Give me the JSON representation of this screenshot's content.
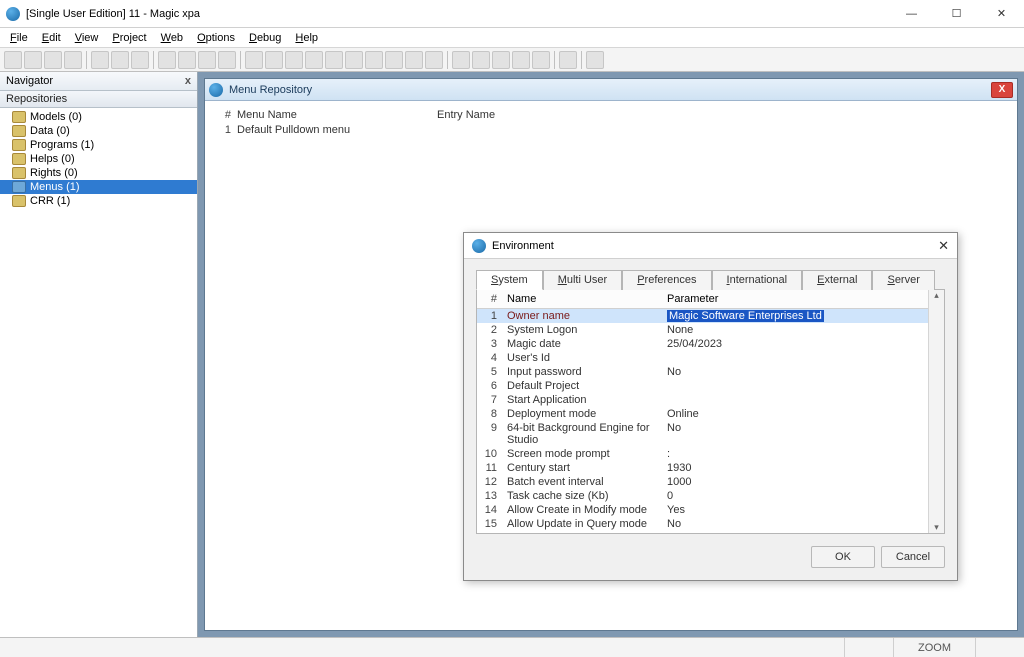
{
  "window": {
    "title": "[Single User Edition] 11 - Magic xpa"
  },
  "menubar": [
    "File",
    "Edit",
    "View",
    "Project",
    "Web",
    "Options",
    "Debug",
    "Help"
  ],
  "navigator": {
    "title": "Navigator",
    "section": "Repositories",
    "items": [
      {
        "label": "Models  (0)"
      },
      {
        "label": "Data  (0)"
      },
      {
        "label": "Programs  (1)"
      },
      {
        "label": "Helps  (0)"
      },
      {
        "label": "Rights  (0)"
      },
      {
        "label": "Menus  (1)",
        "selected": true
      },
      {
        "label": "CRR  (1)"
      }
    ]
  },
  "mdi": {
    "title": "Menu Repository",
    "columns": {
      "index": "#",
      "menu": "Menu Name",
      "entry": "Entry Name"
    },
    "rows": [
      {
        "index": "1",
        "menu": "Default Pulldown menu",
        "entry": ""
      }
    ]
  },
  "env": {
    "title": "Environment",
    "tabs": [
      "System",
      "Multi User",
      "Preferences",
      "International",
      "External",
      "Server"
    ],
    "active_tab": 0,
    "columns": {
      "index": "#",
      "name": "Name",
      "param": "Parameter"
    },
    "rows": [
      {
        "i": "1",
        "name": "Owner name",
        "param": "Magic Software Enterprises Ltd",
        "selected": true
      },
      {
        "i": "2",
        "name": "System Logon",
        "param": "None"
      },
      {
        "i": "3",
        "name": "Magic date",
        "param": "25/04/2023"
      },
      {
        "i": "4",
        "name": "User's Id",
        "param": ""
      },
      {
        "i": "5",
        "name": "Input password",
        "param": "No"
      },
      {
        "i": "6",
        "name": "Default Project",
        "param": ""
      },
      {
        "i": "7",
        "name": "Start Application",
        "param": ""
      },
      {
        "i": "8",
        "name": "Deployment mode",
        "param": "Online"
      },
      {
        "i": "9",
        "name": "64-bit Background Engine for Studio",
        "param": "No"
      },
      {
        "i": "10",
        "name": "Screen mode prompt",
        "param": ":"
      },
      {
        "i": "11",
        "name": "Century start",
        "param": "1930"
      },
      {
        "i": "12",
        "name": "Batch event interval",
        "param": "1000"
      },
      {
        "i": "13",
        "name": "Task cache size (Kb)",
        "param": "0"
      },
      {
        "i": "14",
        "name": "Allow Create in Modify mode",
        "param": "Yes"
      },
      {
        "i": "15",
        "name": "Allow Update in Query mode",
        "param": "No"
      }
    ],
    "ok": "OK",
    "cancel": "Cancel"
  },
  "statusbar": {
    "zoom": "ZOOM"
  }
}
